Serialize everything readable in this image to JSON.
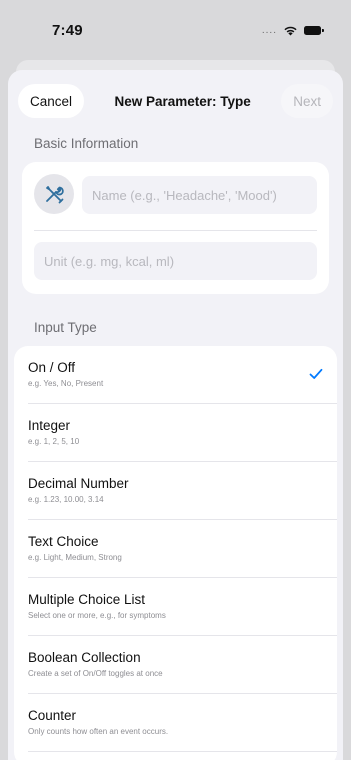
{
  "status_bar": {
    "time": "7:49",
    "signal_dots": "...."
  },
  "nav": {
    "cancel_label": "Cancel",
    "title": "New Parameter: Type",
    "next_label": "Next"
  },
  "basic_info": {
    "header": "Basic Information",
    "icon": "wrench-screwdriver-icon",
    "name_placeholder": "Name (e.g., 'Headache', 'Mood')",
    "unit_placeholder": "Unit (e.g. mg, kcal, ml)"
  },
  "input_type": {
    "header": "Input Type",
    "selected_index": 0,
    "options": [
      {
        "title": "On / Off",
        "subtitle": "e.g. Yes, No, Present"
      },
      {
        "title": "Integer",
        "subtitle": "e.g. 1, 2, 5, 10"
      },
      {
        "title": "Decimal Number",
        "subtitle": "e.g. 1.23, 10.00, 3.14"
      },
      {
        "title": "Text Choice",
        "subtitle": "e.g. Light, Medium, Strong"
      },
      {
        "title": "Multiple Choice List",
        "subtitle": "Select one or more, e.g., for symptoms"
      },
      {
        "title": "Boolean Collection",
        "subtitle": "Create a set of On/Off toggles at once"
      },
      {
        "title": "Counter",
        "subtitle": "Only counts how often an event occurs."
      }
    ]
  },
  "colors": {
    "accent": "#007aff",
    "background": "#f2f2f7",
    "card": "#ffffff",
    "icon_tint": "#2f6f9e"
  }
}
